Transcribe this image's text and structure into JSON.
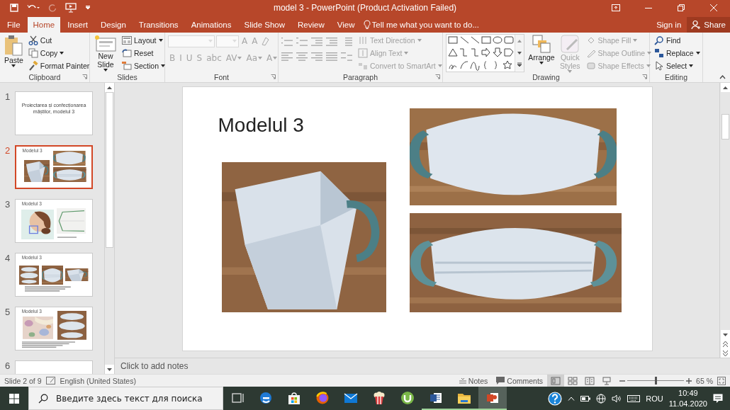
{
  "window": {
    "title": "model 3 - PowerPoint (Product Activation Failed)"
  },
  "quick_access": [
    {
      "kind": "save",
      "disabled": false
    },
    {
      "kind": "undo",
      "disabled": false
    },
    {
      "kind": "redo",
      "disabled": true
    },
    {
      "kind": "present",
      "disabled": false
    },
    {
      "kind": "customize",
      "disabled": false
    }
  ],
  "tabs": [
    {
      "label": "File",
      "selected": false
    },
    {
      "label": "Home",
      "selected": true
    },
    {
      "label": "Insert",
      "selected": false
    },
    {
      "label": "Design",
      "selected": false
    },
    {
      "label": "Transitions",
      "selected": false
    },
    {
      "label": "Animations",
      "selected": false
    },
    {
      "label": "Slide Show",
      "selected": false
    },
    {
      "label": "Review",
      "selected": false
    },
    {
      "label": "View",
      "selected": false
    }
  ],
  "tell_me": {
    "placeholder": "Tell me what you want to do..."
  },
  "account": {
    "sign_in": "Sign in",
    "share": "Share"
  },
  "ribbon": {
    "groups": [
      {
        "kind": "clipboard",
        "label": "Clipboard",
        "launcher": true,
        "items": [
          {
            "label": "Paste",
            "disabled": false,
            "dropdown": true
          },
          {
            "label": "Cut",
            "disabled": false,
            "dropdown": false
          },
          {
            "label": "Copy",
            "disabled": false,
            "dropdown": true
          },
          {
            "label": "Format Painter",
            "disabled": false,
            "dropdown": false
          }
        ]
      },
      {
        "kind": "slides",
        "label": "Slides",
        "launcher": false,
        "items": [
          {
            "label": "New Slide",
            "disabled": false,
            "dropdown": true
          },
          {
            "label": "Layout",
            "disabled": false,
            "dropdown": true
          },
          {
            "label": "Reset",
            "disabled": false,
            "dropdown": false
          },
          {
            "label": "Section",
            "disabled": false,
            "dropdown": true
          }
        ]
      },
      {
        "kind": "font",
        "label": "Font",
        "launcher": true,
        "fields": [
          {
            "disabled": true
          },
          {
            "disabled": true
          }
        ],
        "items": [
          {
            "label": "A",
            "disabled": true,
            "dropdown": false
          },
          {
            "label": "A",
            "disabled": true,
            "dropdown": false
          },
          {
            "label": "B",
            "disabled": true,
            "dropdown": false
          },
          {
            "label": "I",
            "disabled": true,
            "dropdown": false
          },
          {
            "label": "U",
            "disabled": true,
            "dropdown": false
          },
          {
            "label": "S",
            "disabled": true,
            "dropdown": false
          },
          {
            "label": "abc",
            "disabled": true,
            "dropdown": false
          },
          {
            "label": "AV",
            "disabled": true,
            "dropdown": true
          },
          {
            "label": "Aa",
            "disabled": true,
            "dropdown": true
          },
          {
            "label": "A",
            "disabled": true,
            "dropdown": true
          }
        ]
      },
      {
        "kind": "paragraph",
        "label": "Paragraph",
        "launcher": true,
        "tools_disabled": true,
        "items": [
          {
            "label": "Text Direction",
            "disabled": true,
            "dropdown": true
          },
          {
            "label": "Align Text",
            "disabled": true,
            "dropdown": true
          },
          {
            "label": "Convert to SmartArt",
            "disabled": true,
            "dropdown": true
          }
        ]
      },
      {
        "kind": "drawing",
        "label": "Drawing",
        "launcher": true,
        "items": [
          {
            "label": "Arrange",
            "disabled": false,
            "dropdown": true
          },
          {
            "label": "Quick Styles",
            "disabled": true,
            "dropdown": true
          },
          {
            "label": "Shape Fill",
            "disabled": true,
            "dropdown": true
          },
          {
            "label": "Shape Outline",
            "disabled": true,
            "dropdown": true
          },
          {
            "label": "Shape Effects",
            "disabled": true,
            "dropdown": true
          }
        ]
      },
      {
        "kind": "editing",
        "label": "Editing",
        "launcher": false,
        "items": [
          {
            "label": "Find",
            "disabled": false,
            "dropdown": false
          },
          {
            "label": "Replace",
            "disabled": false,
            "dropdown": true
          },
          {
            "label": "Select",
            "disabled": false,
            "dropdown": true
          }
        ]
      }
    ]
  },
  "slides": [
    {
      "number": "1",
      "selected": false,
      "kind": "title",
      "title": "Proiectarea și confecționarea măștilor, modelul 3"
    },
    {
      "number": "2",
      "selected": true,
      "kind": "three_pictures",
      "heading": "Modelul 3"
    },
    {
      "number": "3",
      "selected": false,
      "kind": "picture_caption",
      "heading": "Modelul 3"
    },
    {
      "number": "4",
      "selected": false,
      "kind": "pictures_list",
      "heading": "Modelul 3"
    },
    {
      "number": "5",
      "selected": false,
      "kind": "picture_list",
      "heading": "Modelul 3"
    },
    {
      "number": "6",
      "selected": false,
      "kind": "blank"
    }
  ],
  "slide": {
    "title": "Modelul 3"
  },
  "notes": {
    "placeholder": "Click to add notes"
  },
  "status_bar": {
    "slide_position": "Slide 2 of 9",
    "language": "English (United States)",
    "notes": "Notes",
    "comments": "Comments",
    "views": [
      {
        "kind": "normal",
        "selected": true
      },
      {
        "kind": "sorter",
        "selected": false
      },
      {
        "kind": "reading",
        "selected": false
      },
      {
        "kind": "slideshow",
        "selected": false
      }
    ],
    "zoom": {
      "level": 0.5,
      "reading": "65 %"
    }
  },
  "taskbar": {
    "search": {
      "placeholder": "Введите здесь текст для поиска"
    },
    "apps": [
      {
        "kind": "task_view",
        "running": false,
        "selected": false
      },
      {
        "kind": "edge",
        "running": false,
        "selected": false
      },
      {
        "kind": "store",
        "running": false,
        "selected": false
      },
      {
        "kind": "firefox",
        "running": false,
        "selected": false
      },
      {
        "kind": "mail",
        "running": false,
        "selected": false
      },
      {
        "kind": "popcorn",
        "running": false,
        "selected": false
      },
      {
        "kind": "torrent",
        "running": false,
        "selected": false
      },
      {
        "kind": "word",
        "running": true,
        "selected": false
      },
      {
        "kind": "explorer",
        "running": true,
        "selected": false
      },
      {
        "kind": "powerpoint",
        "running": true,
        "selected": true
      }
    ],
    "language": "ROU",
    "time": "10:49",
    "date": "11.04.2020"
  }
}
